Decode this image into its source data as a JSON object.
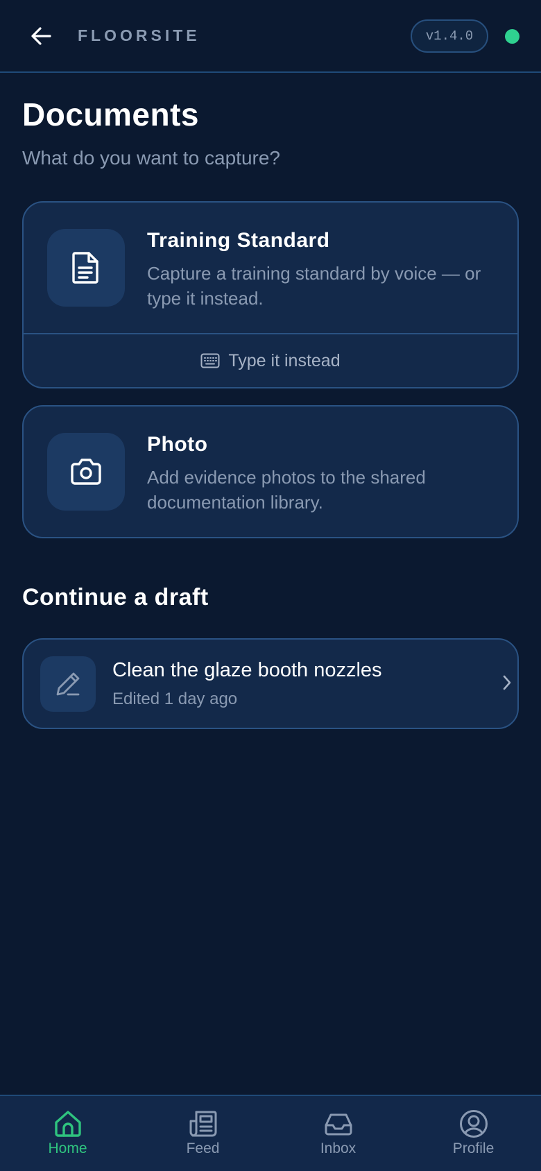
{
  "header": {
    "brand": "FLOORSITE",
    "version": "v1.4.0"
  },
  "page": {
    "title": "Documents",
    "subtitle": "What do you want to capture?"
  },
  "capture_options": [
    {
      "title": "Training Standard",
      "description": "Capture a training standard by voice — or type it instead.",
      "icon": "document-icon",
      "secondary_action": {
        "label": "Type it instead",
        "icon": "keyboard-icon"
      }
    },
    {
      "title": "Photo",
      "description": "Add evidence photos to the shared documentation library.",
      "icon": "camera-icon"
    }
  ],
  "drafts": {
    "section_title": "Continue a draft",
    "items": [
      {
        "title": "Clean the glaze booth nozzles",
        "meta": "Edited 1 day ago",
        "icon": "pencil-icon"
      }
    ]
  },
  "bottom_nav": {
    "items": [
      {
        "label": "Home",
        "icon": "home-icon",
        "active": true
      },
      {
        "label": "Feed",
        "icon": "newspaper-icon",
        "active": false
      },
      {
        "label": "Inbox",
        "icon": "inbox-icon",
        "active": false
      },
      {
        "label": "Profile",
        "icon": "user-circle-icon",
        "active": false
      }
    ]
  },
  "colors": {
    "background": "#0b1930",
    "card": "#13294a",
    "border": "#2a5283",
    "accent_green": "#2fc47f",
    "status_online": "#2fd190",
    "muted_text": "#8a9ab2"
  }
}
